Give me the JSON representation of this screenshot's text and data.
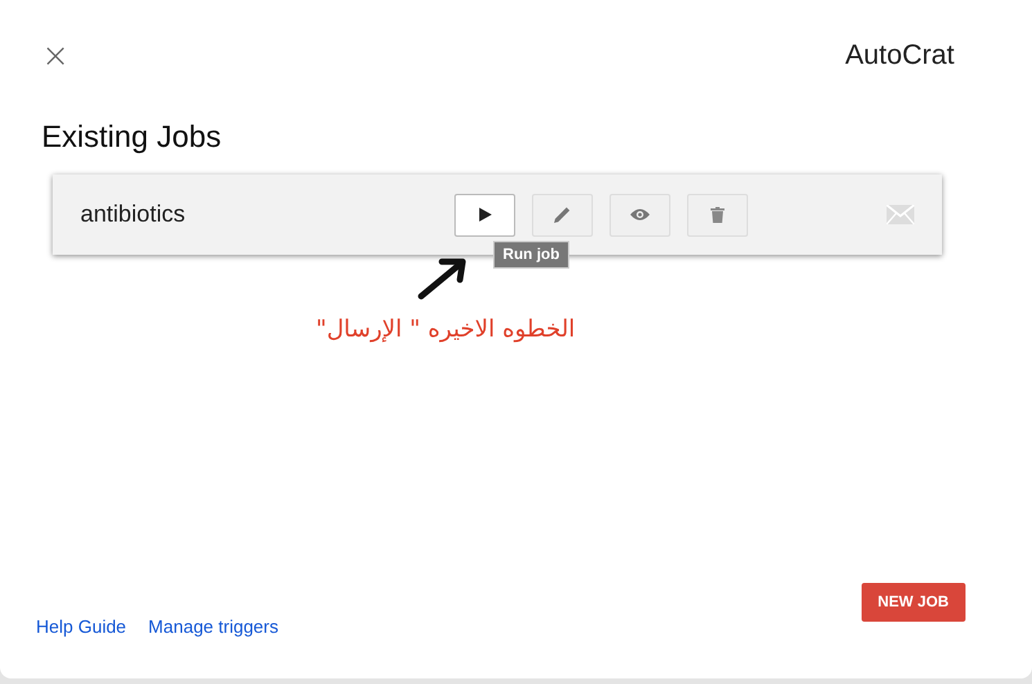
{
  "dialog": {
    "title": "AutoCrat",
    "close": "×"
  },
  "heading": "Existing Jobs",
  "jobs": [
    {
      "name": "antibiotics",
      "actions": [
        {
          "kind": "run",
          "highlighted": true
        },
        {
          "kind": "edit",
          "highlighted": false
        },
        {
          "kind": "preview",
          "highlighted": false
        },
        {
          "kind": "delete",
          "highlighted": false
        }
      ],
      "tooltip": "Run job"
    }
  ],
  "annotation": "الخطوه الاخيره \" الإرسال\"",
  "footer": {
    "links": [
      "Help Guide",
      "Manage triggers"
    ],
    "button": "NEW JOB"
  }
}
